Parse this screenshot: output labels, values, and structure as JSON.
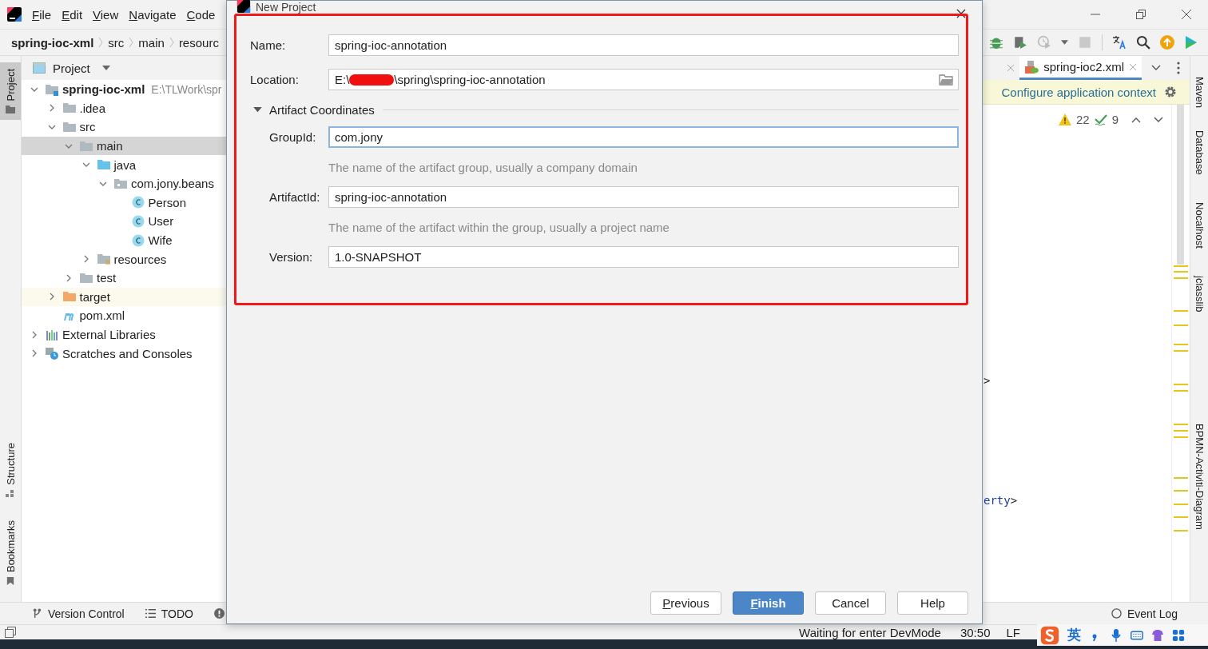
{
  "menu": [
    "File",
    "Edit",
    "View",
    "Navigate",
    "Code"
  ],
  "breadcrumb": [
    "spring-ioc-xml",
    "src",
    "main",
    "resourc"
  ],
  "left_strip": [
    {
      "label": "Project",
      "selected": true,
      "kind": "project"
    },
    {
      "label": "Structure",
      "selected": false,
      "kind": "structure"
    },
    {
      "label": "Bookmarks",
      "selected": false,
      "kind": "bookmarks"
    }
  ],
  "project_panel": {
    "title": "Project",
    "tree": [
      {
        "name": "spring-ioc-xml",
        "path": "E:\\TLWork\\spr",
        "kind": "module",
        "expanded": true,
        "selected": false,
        "children": [
          {
            "name": ".idea",
            "kind": "folder",
            "expanded": false,
            "selected": false
          },
          {
            "name": "src",
            "kind": "folder",
            "expanded": true,
            "selected": false,
            "children": [
              {
                "name": "main",
                "kind": "folder",
                "expanded": true,
                "selected": true,
                "children": [
                  {
                    "name": "java",
                    "kind": "source-folder",
                    "expanded": true,
                    "selected": false,
                    "children": [
                      {
                        "name": "com.jony.beans",
                        "kind": "package",
                        "expanded": true,
                        "selected": false,
                        "children": [
                          {
                            "name": "Person",
                            "kind": "class",
                            "selected": false
                          },
                          {
                            "name": "User",
                            "kind": "class",
                            "selected": false
                          },
                          {
                            "name": "Wife",
                            "kind": "class",
                            "selected": false
                          }
                        ]
                      }
                    ]
                  },
                  {
                    "name": "resources",
                    "kind": "resources-folder",
                    "expanded": false,
                    "selected": false
                  }
                ]
              },
              {
                "name": "test",
                "kind": "folder",
                "expanded": false,
                "selected": false
              }
            ]
          },
          {
            "name": "target",
            "kind": "excluded-folder",
            "expanded": false,
            "selected": false
          },
          {
            "name": "pom.xml",
            "kind": "maven",
            "selected": false
          }
        ]
      },
      {
        "name": "External Libraries",
        "kind": "libraries",
        "expanded": false,
        "selected": false
      },
      {
        "name": "Scratches and Consoles",
        "kind": "scratches",
        "expanded": false,
        "selected": false
      }
    ]
  },
  "editor": {
    "tabs": [
      {
        "selected": false
      },
      {
        "label": "spring-ioc2.xml",
        "selected": true
      }
    ],
    "banner": "Configure application context",
    "warnings": "22",
    "ok": "9",
    "code_lines": [
      [
        {
          "text": ">",
          "kind": "punct"
        }
      ],
      [
        {
          "text": "erty",
          "kind": "tag"
        },
        {
          "text": ">",
          "kind": "punct"
        }
      ]
    ]
  },
  "right_strip": [
    "Maven",
    "Database",
    "Nocalhost",
    "jclasslib",
    "BPMN-Activiti-Diagram"
  ],
  "bottom_tools": [
    {
      "label": "Version Control",
      "kind": "vcs"
    },
    {
      "label": "TODO",
      "kind": "todo"
    },
    {
      "kind": "problems"
    }
  ],
  "event_log": "Event Log",
  "status": {
    "message": "Waiting for enter DevMode",
    "position": "30:50",
    "line_ending": "LF"
  },
  "ime": {
    "mode": "英"
  },
  "dialog": {
    "title": "New Project",
    "name": {
      "label": "Name:",
      "value": "spring-ioc-annotation"
    },
    "location": {
      "label": "Location:",
      "value_start": "E:\\",
      "value_end": "\\spring\\spring-ioc-annotation",
      "redacted": true
    },
    "section": {
      "label": "Artifact Coordinates",
      "expanded": true
    },
    "fields": [
      {
        "label": "GroupId:",
        "value": "com.jony",
        "focused": true,
        "hint": "The name of the artifact group, usually a company domain"
      },
      {
        "label": "ArtifactId:",
        "value": "spring-ioc-annotation",
        "focused": false,
        "hint": "The name of the artifact within the group, usually a project name"
      },
      {
        "label": "Version:",
        "value": "1.0-SNAPSHOT",
        "focused": false
      }
    ],
    "highlighted": true,
    "buttons": [
      {
        "label": "Previous",
        "primary": false,
        "mnemonic": true
      },
      {
        "label": "Finish",
        "primary": true,
        "mnemonic": true
      },
      {
        "label": "Cancel",
        "primary": false,
        "mnemonic": false
      },
      {
        "label": "Help",
        "primary": false,
        "mnemonic": false
      }
    ]
  }
}
